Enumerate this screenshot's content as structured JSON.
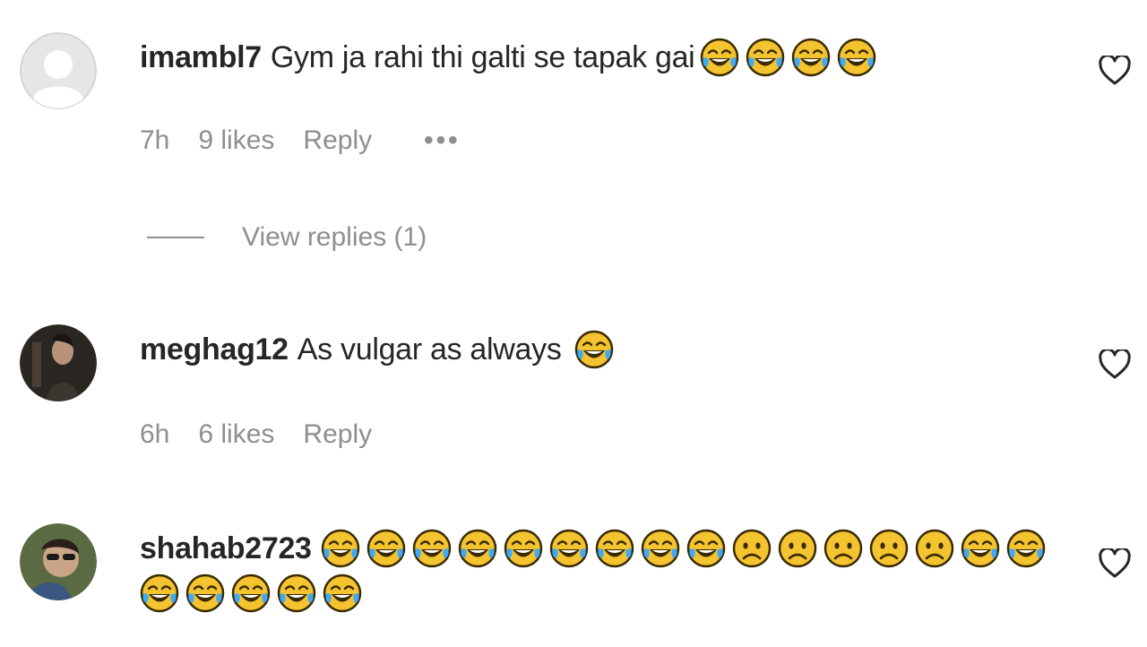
{
  "comments": [
    {
      "username": "imambl7",
      "text": "Gym ja rahi thi galti se tapak gai",
      "emojis_line1": [
        "joy",
        "joy",
        "joy",
        "joy"
      ],
      "emojis_line2": [],
      "time": "7h",
      "likes": "9 likes",
      "reply_label": "Reply",
      "more_label": "•••",
      "view_replies": "View replies (1)",
      "avatar": "default-avatar"
    },
    {
      "username": "meghag12",
      "text": "As vulgar as always",
      "emojis_line1": [
        "joy"
      ],
      "emojis_line2": [],
      "time": "6h",
      "likes": "6 likes",
      "reply_label": "Reply",
      "avatar": "photo-avatar"
    },
    {
      "username": "shahab2723",
      "text": "",
      "emojis_line1": [
        "joy",
        "joy",
        "joy",
        "joy",
        "joy",
        "joy",
        "joy",
        "joy",
        "joy",
        "sad",
        "sad",
        "sad",
        "sad",
        "sad",
        "joy",
        "joy"
      ],
      "emojis_line2": [
        "joy",
        "joy",
        "joy",
        "joy",
        "joy"
      ],
      "avatar": "photo-avatar"
    }
  ],
  "colors": {
    "text": "#262626",
    "meta": "#8e8e8e",
    "emoji_face": "#f4c430",
    "emoji_outline": "#3a2a00",
    "tear": "#3fa9f5"
  }
}
